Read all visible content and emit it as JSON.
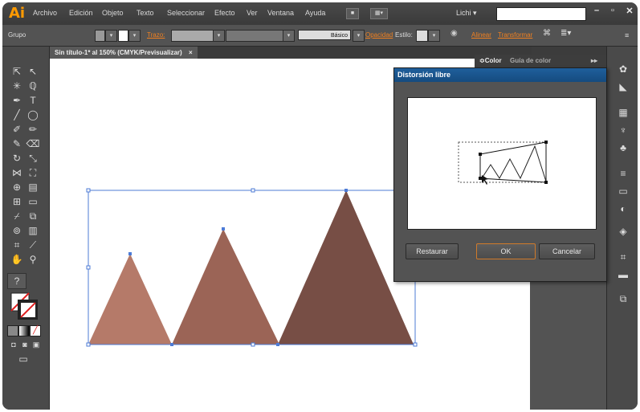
{
  "app": {
    "logo": "Ai"
  },
  "menu": {
    "items": [
      "Archivo",
      "Edición",
      "Objeto",
      "Texto",
      "Seleccionar",
      "Efecto",
      "Ver",
      "Ventana",
      "Ayuda"
    ],
    "user": "Lichi ▾"
  },
  "control": {
    "group_label": "Grupo",
    "stroke_label": "Trazo:",
    "basic_label": "Básico",
    "opacity_label": "Opacidad",
    "style_label": "Estilo:",
    "align_label": "Alinear",
    "transform_label": "Transformar"
  },
  "document": {
    "tab_title": "Sin título-1* al 150% (CMYK/Previsualizar)",
    "close": "×"
  },
  "panel": {
    "tab_color": "≎Color",
    "tab_guide": "Guía de color"
  },
  "dialog": {
    "title": "Distorsión libre",
    "reset_label": "Restaurar",
    "ok_label": "OK",
    "cancel_label": "Cancelar"
  },
  "colors": {
    "tri1": "#b57a69",
    "tri2": "#9b6456",
    "tri3": "#774e45",
    "selection": "#4d7bd6",
    "accent": "#f08020"
  },
  "icons": [
    "selection-tool",
    "direct-selection-tool",
    "magic-wand",
    "lasso",
    "pen-tool",
    "type-tool",
    "line-tool",
    "ellipse-tool",
    "brush-tool",
    "pencil-tool",
    "blob-brush",
    "eraser-tool",
    "rotate-tool",
    "scale-tool",
    "width-tool",
    "free-transform",
    "shape-builder",
    "perspective-grid",
    "mesh-tool",
    "gradient-tool",
    "eyedropper",
    "blend-tool",
    "symbol-sprayer",
    "graph-tool",
    "artboard-tool",
    "slice-tool",
    "hand-tool",
    "zoom-tool"
  ]
}
